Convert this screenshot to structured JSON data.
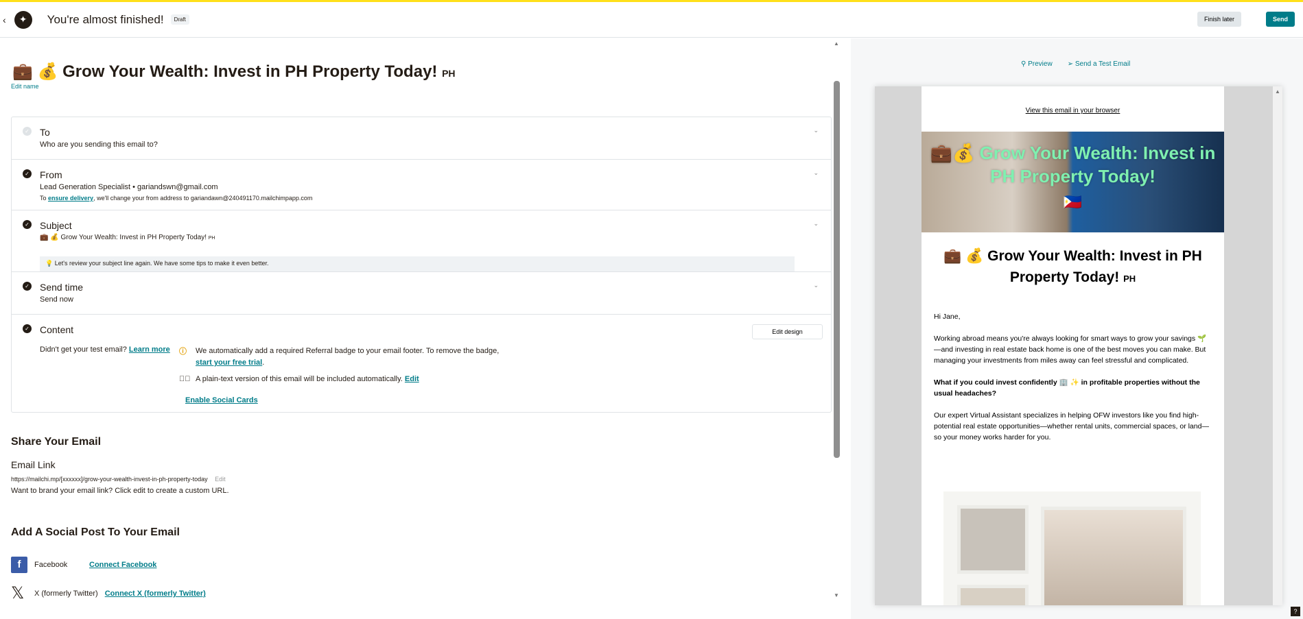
{
  "header": {
    "title": "You're almost finished!",
    "badge": "Draft",
    "finish_later": "Finish later",
    "send": "Send"
  },
  "campaign": {
    "title": "💼 💰 Grow Your Wealth: Invest in PH Property Today!",
    "title_suffix": "PH",
    "edit_name": "Edit name"
  },
  "checklist": {
    "to": {
      "title": "To",
      "subtitle": "Who are you sending this email to?"
    },
    "from": {
      "title": "From",
      "sender": "Lead Generation Specialist • gariandswn@gmail.com",
      "note_prefix": "To ",
      "note_link": "ensure delivery",
      "note_suffix": ", we'll change your from address to gariandawn@240491170.mailchimpapp.com"
    },
    "subject": {
      "title": "Subject",
      "value": "💼 💰 Grow Your Wealth: Invest in PH Property Today!",
      "value_suffix": "PH",
      "tip": "Let's review your subject line again. We have some tips to make it even better."
    },
    "send_time": {
      "title": "Send time",
      "value": "Send now"
    },
    "content": {
      "title": "Content",
      "edit_design": "Edit design",
      "test_q": "Didn't get your test email?",
      "learn_more": "Learn more",
      "badge_note": "We automatically add a required Referral badge to your email footer. To remove the badge,",
      "trial_link": "start your free trial",
      "plain_text": "A plain-text version of this email will be included automatically.",
      "plain_edit": "Edit",
      "social_cards": "Enable Social Cards"
    }
  },
  "share": {
    "title": "Share Your Email",
    "link_label": "Email Link",
    "url": "https://mailchi.mp/[xxxxxx]/grow-your-wealth-invest-in-ph-property-today",
    "edit": "Edit",
    "hint": "Want to brand your email link? Click edit to create a custom URL."
  },
  "social": {
    "title": "Add A Social Post To Your Email",
    "facebook": "Facebook",
    "connect_facebook": "Connect Facebook",
    "x": "X (formerly Twitter)",
    "connect_x": "Connect X (formerly Twitter)"
  },
  "preview": {
    "preview": "Preview",
    "send_test": "Send a Test Email",
    "email": {
      "view_browser": "View this email in your browser",
      "hero_text": "💼💰 Grow Your Wealth: Invest in PH Property Today!",
      "hero_flag": "🇵🇭",
      "heading": "💼 💰 Grow Your Wealth: Invest in PH Property Today!",
      "heading_suffix": "PH",
      "greeting": "Hi Jane,",
      "p1": "Working abroad means you're always looking for smart ways to grow your savings 🌱—and investing in real estate back home is one of the best moves you can make. But managing your investments from miles away can feel stressful and complicated.",
      "p2": "What if you could invest confidently 🏢 ✨ in profitable properties without the usual headaches?",
      "p3": "Our expert Virtual Assistant specializes in helping OFW investors like you find high-potential real estate opportunities—whether rental units, commercial spaces, or land—so your money works harder for you."
    }
  },
  "help": "?"
}
